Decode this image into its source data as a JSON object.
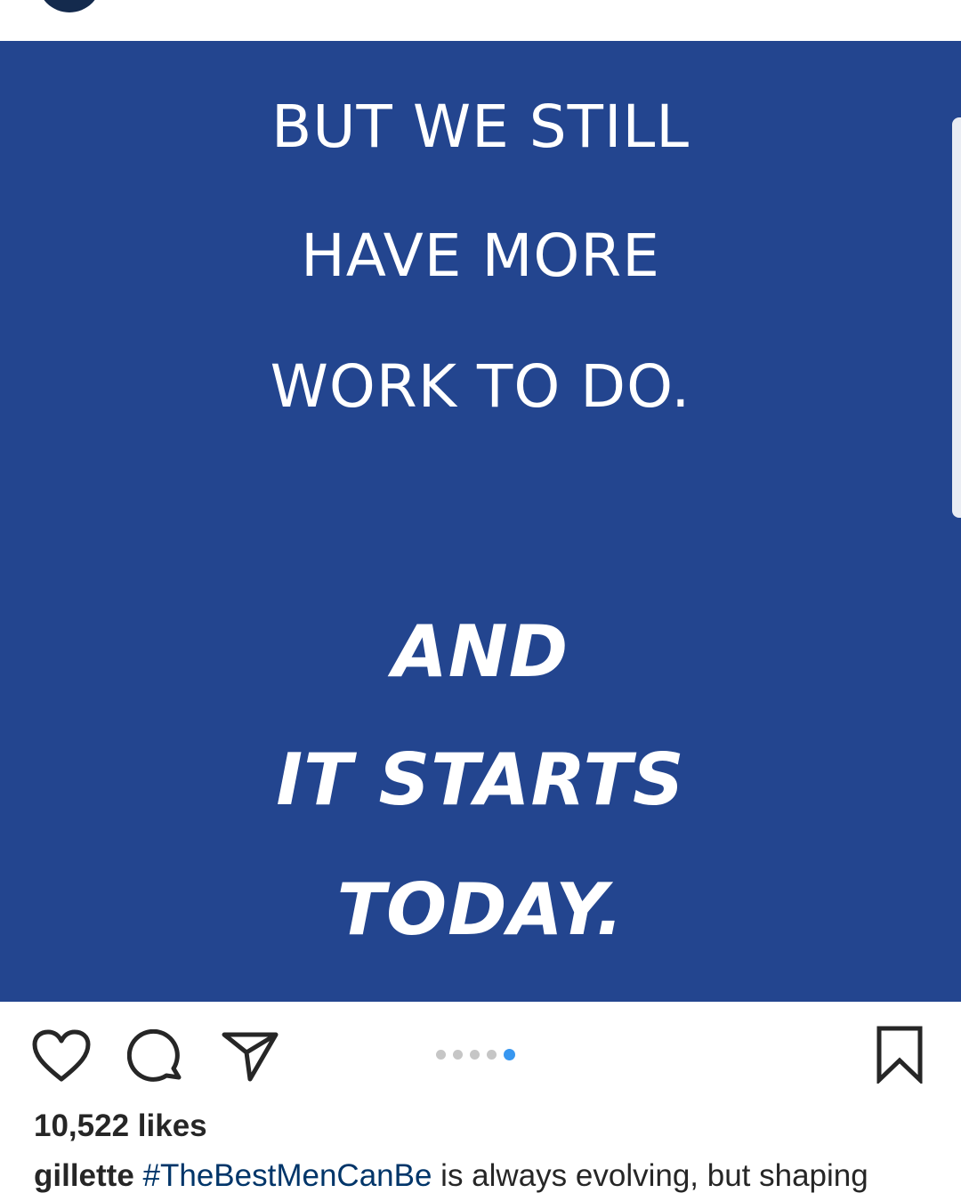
{
  "post": {
    "image_lines": {
      "line1": "BUT WE STILL",
      "line2": "HAVE MORE",
      "line3": "WORK TO DO.",
      "line4": "AND",
      "line5": "IT STARTS",
      "line6": "TODAY."
    },
    "background_color": "#23458f",
    "carousel": {
      "total": 5,
      "current": 5
    }
  },
  "actions": {
    "icons": [
      "heart-icon",
      "comment-icon",
      "share-icon",
      "bookmark-icon"
    ]
  },
  "likes_text": "10,522 likes",
  "caption": {
    "username": "gillette",
    "hashtag": "#TheBestMenCanBe",
    "text": " is always evolving, but shaping"
  },
  "colors": {
    "accent": "#3897f0",
    "hashtag": "#003569",
    "text": "#262626"
  }
}
